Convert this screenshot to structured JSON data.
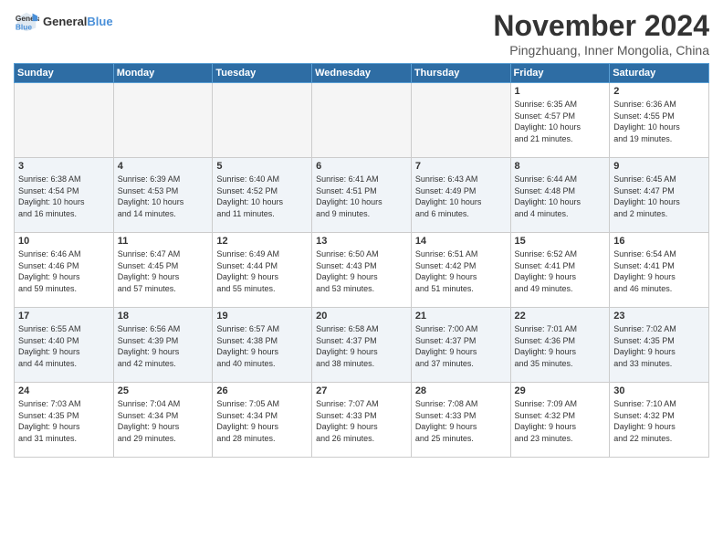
{
  "header": {
    "logo_line1": "General",
    "logo_line2": "Blue",
    "month": "November 2024",
    "location": "Pingzhuang, Inner Mongolia, China"
  },
  "weekdays": [
    "Sunday",
    "Monday",
    "Tuesday",
    "Wednesday",
    "Thursday",
    "Friday",
    "Saturday"
  ],
  "weeks": [
    [
      {
        "day": "",
        "info": ""
      },
      {
        "day": "",
        "info": ""
      },
      {
        "day": "",
        "info": ""
      },
      {
        "day": "",
        "info": ""
      },
      {
        "day": "",
        "info": ""
      },
      {
        "day": "1",
        "info": "Sunrise: 6:35 AM\nSunset: 4:57 PM\nDaylight: 10 hours\nand 21 minutes."
      },
      {
        "day": "2",
        "info": "Sunrise: 6:36 AM\nSunset: 4:55 PM\nDaylight: 10 hours\nand 19 minutes."
      }
    ],
    [
      {
        "day": "3",
        "info": "Sunrise: 6:38 AM\nSunset: 4:54 PM\nDaylight: 10 hours\nand 16 minutes."
      },
      {
        "day": "4",
        "info": "Sunrise: 6:39 AM\nSunset: 4:53 PM\nDaylight: 10 hours\nand 14 minutes."
      },
      {
        "day": "5",
        "info": "Sunrise: 6:40 AM\nSunset: 4:52 PM\nDaylight: 10 hours\nand 11 minutes."
      },
      {
        "day": "6",
        "info": "Sunrise: 6:41 AM\nSunset: 4:51 PM\nDaylight: 10 hours\nand 9 minutes."
      },
      {
        "day": "7",
        "info": "Sunrise: 6:43 AM\nSunset: 4:49 PM\nDaylight: 10 hours\nand 6 minutes."
      },
      {
        "day": "8",
        "info": "Sunrise: 6:44 AM\nSunset: 4:48 PM\nDaylight: 10 hours\nand 4 minutes."
      },
      {
        "day": "9",
        "info": "Sunrise: 6:45 AM\nSunset: 4:47 PM\nDaylight: 10 hours\nand 2 minutes."
      }
    ],
    [
      {
        "day": "10",
        "info": "Sunrise: 6:46 AM\nSunset: 4:46 PM\nDaylight: 9 hours\nand 59 minutes."
      },
      {
        "day": "11",
        "info": "Sunrise: 6:47 AM\nSunset: 4:45 PM\nDaylight: 9 hours\nand 57 minutes."
      },
      {
        "day": "12",
        "info": "Sunrise: 6:49 AM\nSunset: 4:44 PM\nDaylight: 9 hours\nand 55 minutes."
      },
      {
        "day": "13",
        "info": "Sunrise: 6:50 AM\nSunset: 4:43 PM\nDaylight: 9 hours\nand 53 minutes."
      },
      {
        "day": "14",
        "info": "Sunrise: 6:51 AM\nSunset: 4:42 PM\nDaylight: 9 hours\nand 51 minutes."
      },
      {
        "day": "15",
        "info": "Sunrise: 6:52 AM\nSunset: 4:41 PM\nDaylight: 9 hours\nand 49 minutes."
      },
      {
        "day": "16",
        "info": "Sunrise: 6:54 AM\nSunset: 4:41 PM\nDaylight: 9 hours\nand 46 minutes."
      }
    ],
    [
      {
        "day": "17",
        "info": "Sunrise: 6:55 AM\nSunset: 4:40 PM\nDaylight: 9 hours\nand 44 minutes."
      },
      {
        "day": "18",
        "info": "Sunrise: 6:56 AM\nSunset: 4:39 PM\nDaylight: 9 hours\nand 42 minutes."
      },
      {
        "day": "19",
        "info": "Sunrise: 6:57 AM\nSunset: 4:38 PM\nDaylight: 9 hours\nand 40 minutes."
      },
      {
        "day": "20",
        "info": "Sunrise: 6:58 AM\nSunset: 4:37 PM\nDaylight: 9 hours\nand 38 minutes."
      },
      {
        "day": "21",
        "info": "Sunrise: 7:00 AM\nSunset: 4:37 PM\nDaylight: 9 hours\nand 37 minutes."
      },
      {
        "day": "22",
        "info": "Sunrise: 7:01 AM\nSunset: 4:36 PM\nDaylight: 9 hours\nand 35 minutes."
      },
      {
        "day": "23",
        "info": "Sunrise: 7:02 AM\nSunset: 4:35 PM\nDaylight: 9 hours\nand 33 minutes."
      }
    ],
    [
      {
        "day": "24",
        "info": "Sunrise: 7:03 AM\nSunset: 4:35 PM\nDaylight: 9 hours\nand 31 minutes."
      },
      {
        "day": "25",
        "info": "Sunrise: 7:04 AM\nSunset: 4:34 PM\nDaylight: 9 hours\nand 29 minutes."
      },
      {
        "day": "26",
        "info": "Sunrise: 7:05 AM\nSunset: 4:34 PM\nDaylight: 9 hours\nand 28 minutes."
      },
      {
        "day": "27",
        "info": "Sunrise: 7:07 AM\nSunset: 4:33 PM\nDaylight: 9 hours\nand 26 minutes."
      },
      {
        "day": "28",
        "info": "Sunrise: 7:08 AM\nSunset: 4:33 PM\nDaylight: 9 hours\nand 25 minutes."
      },
      {
        "day": "29",
        "info": "Sunrise: 7:09 AM\nSunset: 4:32 PM\nDaylight: 9 hours\nand 23 minutes."
      },
      {
        "day": "30",
        "info": "Sunrise: 7:10 AM\nSunset: 4:32 PM\nDaylight: 9 hours\nand 22 minutes."
      }
    ]
  ]
}
